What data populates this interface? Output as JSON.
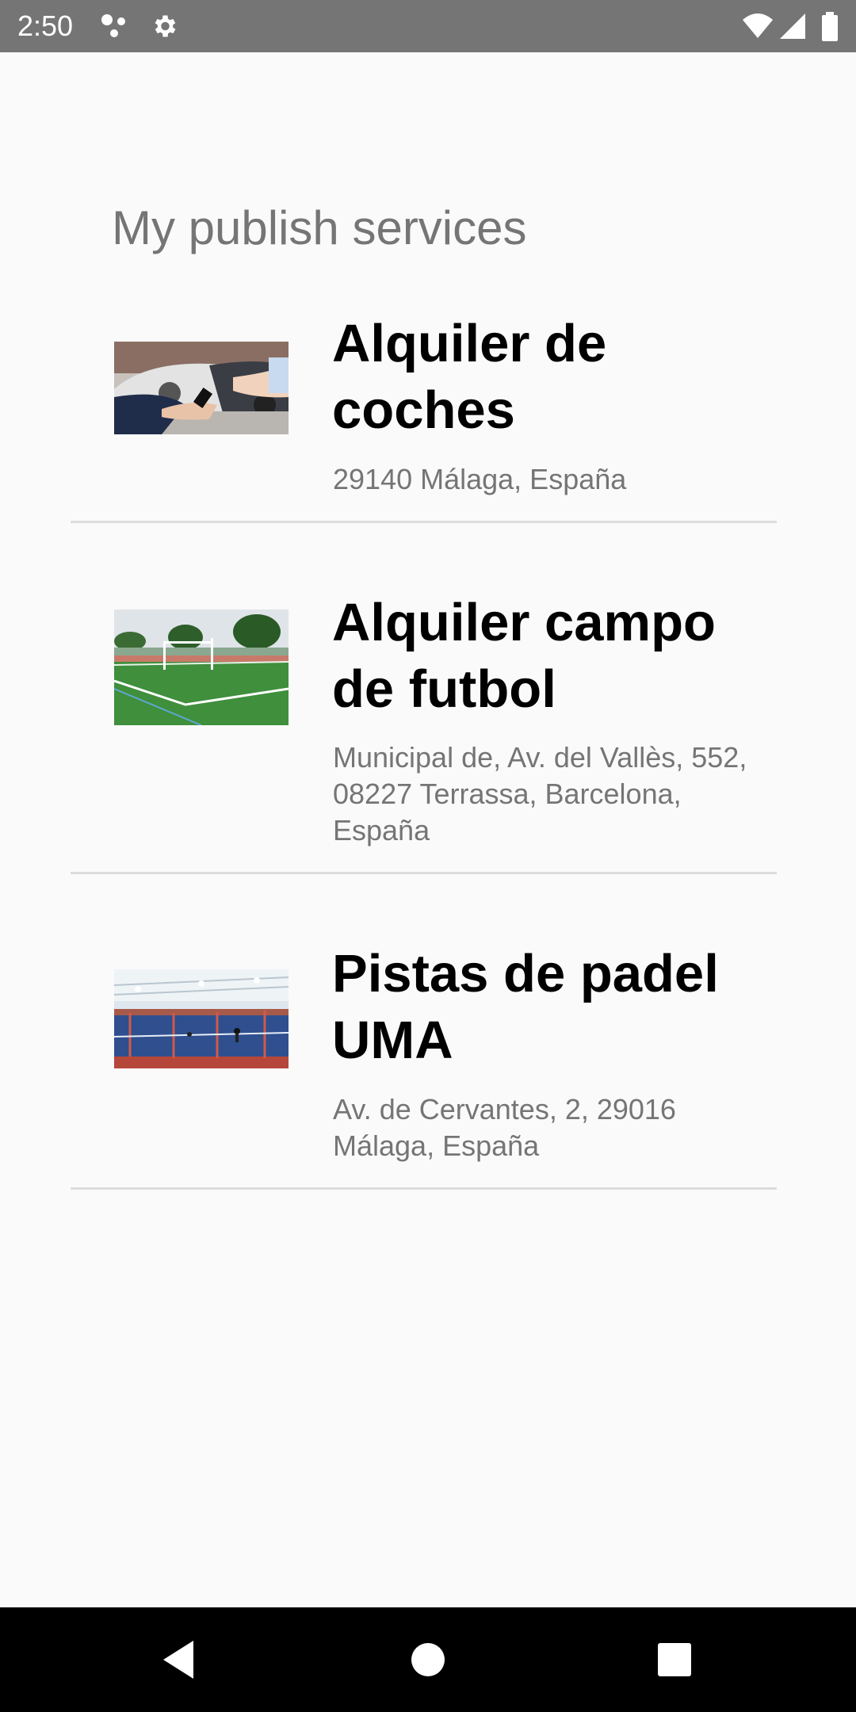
{
  "status_bar": {
    "time": "2:50",
    "left_icons": [
      "dots-icon",
      "gear-icon"
    ],
    "right_icons": [
      "wifi-icon",
      "signal-icon",
      "battery-icon"
    ]
  },
  "page": {
    "title": "My publish services"
  },
  "services": [
    {
      "name": "Alquiler de coches",
      "address": "29140 Málaga, España",
      "image": "car-keys-photo"
    },
    {
      "name": "Alquiler campo de futbol",
      "address": "Municipal de, Av. del Vallès, 552, 08227 Terrassa, Barcelona, España",
      "image": "football-field-photo"
    },
    {
      "name": "Pistas de padel UMA",
      "address": "Av. de Cervantes, 2, 29016 Málaga, España",
      "image": "padel-courts-photo"
    }
  ],
  "nav_bar": {
    "buttons": [
      "back-icon",
      "home-icon",
      "recents-icon"
    ]
  },
  "colors": {
    "status_bar": "#757575",
    "background": "#fafafa",
    "title_text": "#757575",
    "name_text": "#000000",
    "address_text": "#757575",
    "divider": "#dcdcdc",
    "nav_bar": "#000000"
  }
}
